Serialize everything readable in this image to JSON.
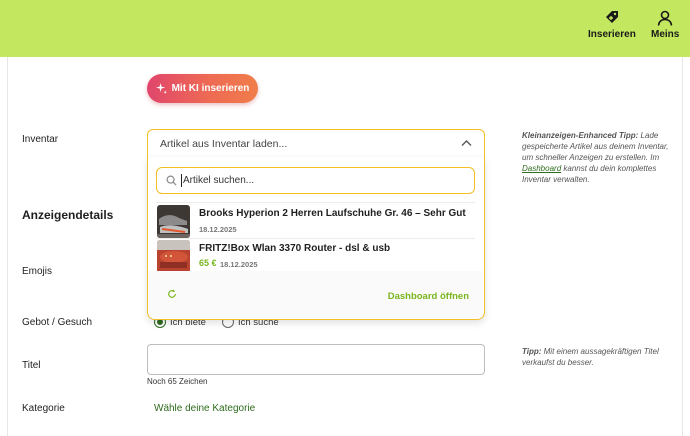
{
  "header": {
    "insert_label": "Inserieren",
    "insert_icon": "tag-plus-icon",
    "profile_label": "Meins",
    "profile_icon": "user-icon",
    "bar_color": "#c3e75e"
  },
  "ai_button": {
    "label": "Mit KI inserieren",
    "icon": "sparkle-icon"
  },
  "form": {
    "inventar_label": "Inventar",
    "section_title": "Anzeigendetails",
    "emojis_label": "Emojis",
    "offer_label": "Gebot / Gesuch",
    "title_label": "Titel",
    "category_label": "Kategorie",
    "offer_options": [
      {
        "label": "Ich biete",
        "selected": true
      },
      {
        "label": "Ich suche",
        "selected": false
      }
    ],
    "title_hint": "Noch 65 Zeichen",
    "category_link": "Wähle deine Kategorie"
  },
  "inventory_select": {
    "value": "Artikel aus Inventar laden...",
    "search_placeholder": "Artikel suchen...",
    "items": [
      {
        "title": "Brooks Hyperion 2 Herren Laufschuhe Gr. 46 – Sehr Gut",
        "price": "",
        "date": "18.12.2025"
      },
      {
        "title": "FRITZ!Box Wlan 3370 Router - dsl & usb",
        "price": "65 €",
        "date": "18.12.2025"
      }
    ],
    "dashboard_link": "Dashboard öffnen"
  },
  "tips": {
    "inventory_tip_title": "Kleinanzeigen-Enhanced Tipp:",
    "inventory_tip_text_1": "Lade gespeicherte Artikel aus deinem Inventar, um schneller Anzeigen zu erstellen. Im",
    "inventory_tip_link": "Dashboard",
    "inventory_tip_text_2": "kannst du dein komplettes Inventar verwalten.",
    "title_tip_title": "Tipp:",
    "title_tip_text": "Mit einem aussagekräftigen Titel verkaufst du besser."
  },
  "colors": {
    "accent_green": "#7ab51d",
    "link_green": "#2e6c1e",
    "focus_yellow": "#f2bf26"
  }
}
